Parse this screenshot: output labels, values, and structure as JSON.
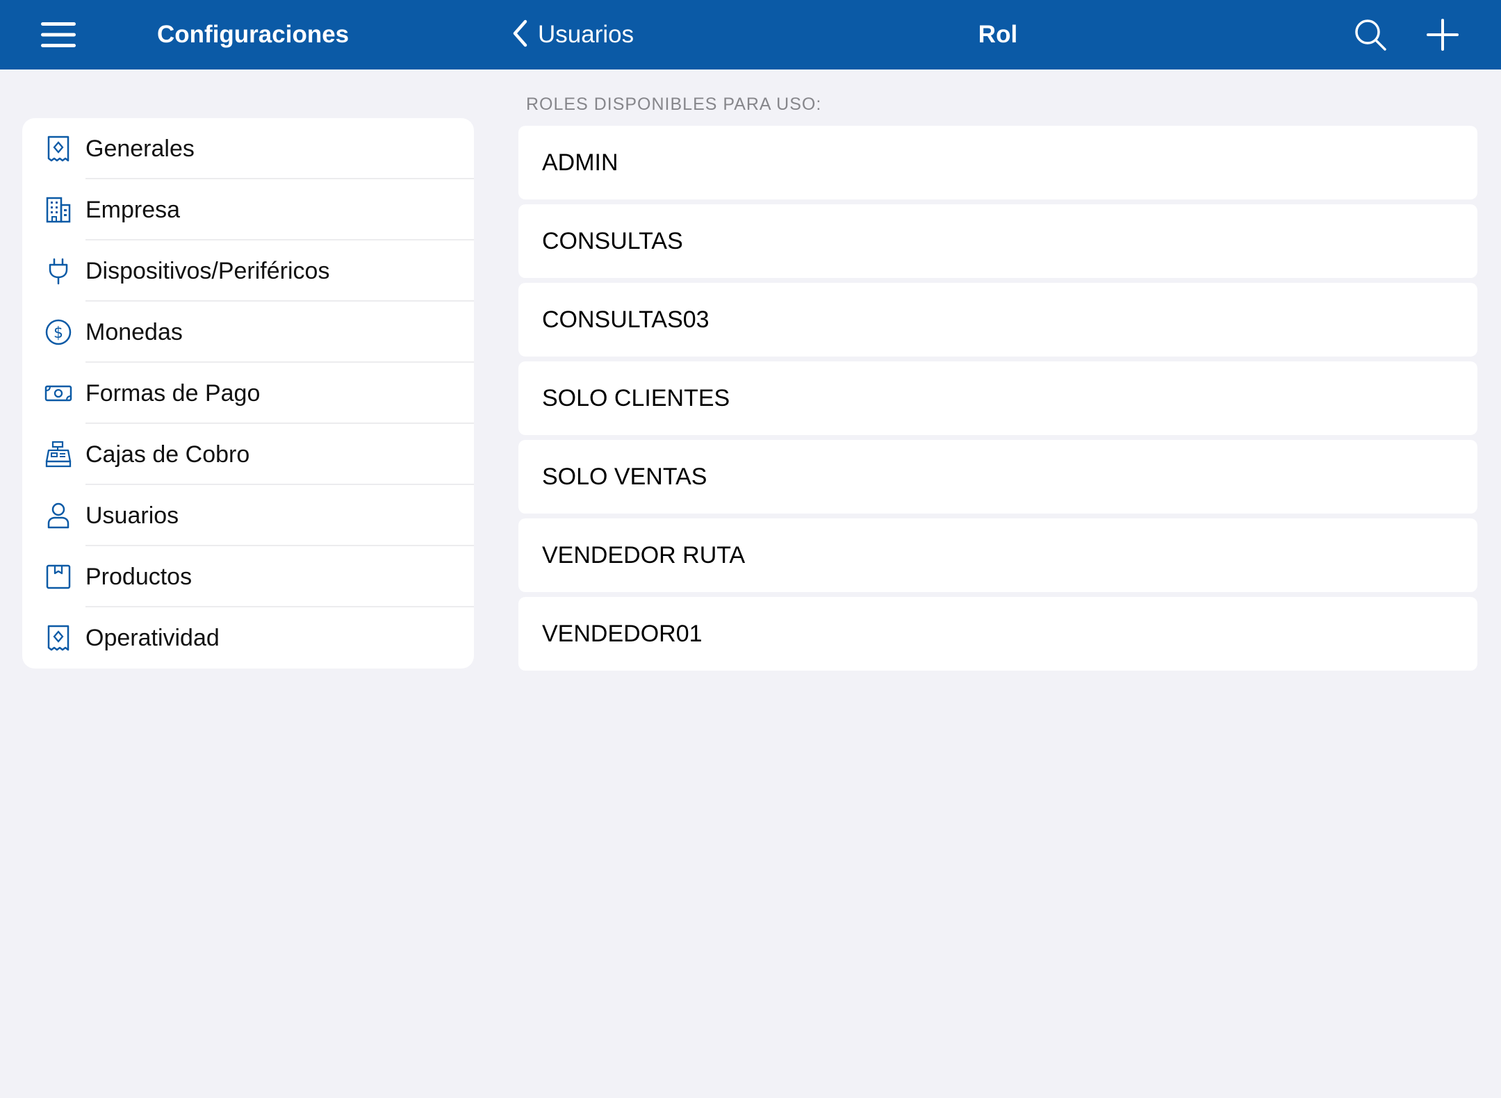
{
  "colors": {
    "accent": "#0b5aa6",
    "background": "#f2f2f7",
    "surface": "#ffffff",
    "section_header_text": "#86868b"
  },
  "topbar": {
    "menu_icon": "hamburger-menu-icon",
    "sidebar_title": "Configuraciones",
    "back_label": "Usuarios",
    "back_icon": "chevron-left-icon",
    "title": "Rol",
    "search_icon": "search-icon",
    "add_icon": "plus-icon"
  },
  "sidebar": {
    "items": [
      {
        "label": "Generales",
        "icon": "receipt-icon"
      },
      {
        "label": "Empresa",
        "icon": "building-icon"
      },
      {
        "label": "Dispositivos/Periféricos",
        "icon": "plug-icon"
      },
      {
        "label": "Monedas",
        "icon": "dollar-circle-icon"
      },
      {
        "label": "Formas de Pago",
        "icon": "banknote-icon"
      },
      {
        "label": "Cajas de Cobro",
        "icon": "cash-register-icon"
      },
      {
        "label": "Usuarios",
        "icon": "person-icon"
      },
      {
        "label": "Productos",
        "icon": "product-box-icon"
      },
      {
        "label": "Operatividad",
        "icon": "receipt-icon"
      }
    ]
  },
  "main": {
    "section_header": "ROLES DISPONIBLES PARA USO:",
    "roles": [
      "ADMIN",
      "CONSULTAS",
      "CONSULTAS03",
      "SOLO CLIENTES",
      "SOLO VENTAS",
      "VENDEDOR RUTA",
      "VENDEDOR01"
    ]
  }
}
